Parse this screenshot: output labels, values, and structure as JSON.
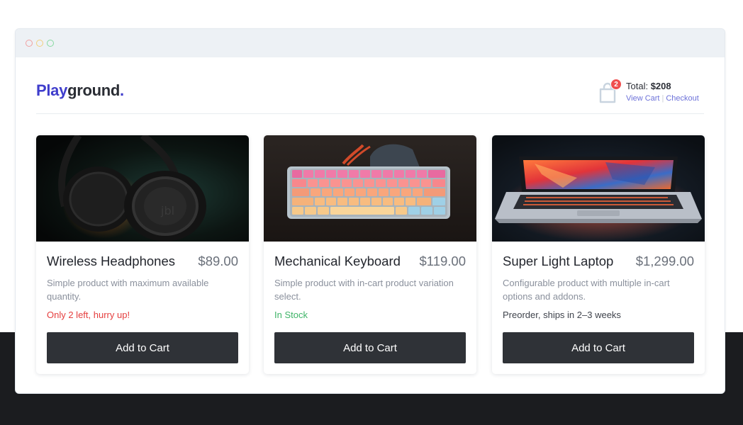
{
  "window": {
    "controls": [
      "close",
      "minimize",
      "maximize"
    ],
    "colors": {
      "close": "#f0a0a0",
      "minimize": "#f2cf7d",
      "maximize": "#86d9a0"
    }
  },
  "brand": {
    "part1": "Play",
    "part2": "ground",
    "part3": ".",
    "accent_color": "#3f3dcc"
  },
  "cart": {
    "icon": "shopping-bag-icon",
    "count": "2",
    "total_label": "Total: ",
    "total_value": "$208",
    "view_cart": "View Cart",
    "separator": "|",
    "checkout": "Checkout"
  },
  "products": [
    {
      "image": "headphones-image",
      "name": "Wireless Headphones",
      "price": "$89.00",
      "description": "Simple product with maximum available quantity.",
      "stock": "Only 2 left, hurry up!",
      "stock_color": "#e53e3e",
      "button": "Add to Cart"
    },
    {
      "image": "keyboard-image",
      "name": "Mechanical Keyboard",
      "price": "$119.00",
      "description": "Simple product with in-cart product variation select.",
      "stock": "In Stock",
      "stock_color": "#3fb468",
      "button": "Add to Cart"
    },
    {
      "image": "laptop-image",
      "name": "Super Light Laptop",
      "price": "$1,299.00",
      "description": "Configurable product with multiple in-cart options and addons.",
      "stock": "Preorder, ships in 2–3 weeks",
      "stock_color": "#3f434c",
      "button": "Add to Cart"
    }
  ],
  "theme": {
    "button_bg": "#2f3237",
    "page_dark": "#1b1c1f"
  }
}
